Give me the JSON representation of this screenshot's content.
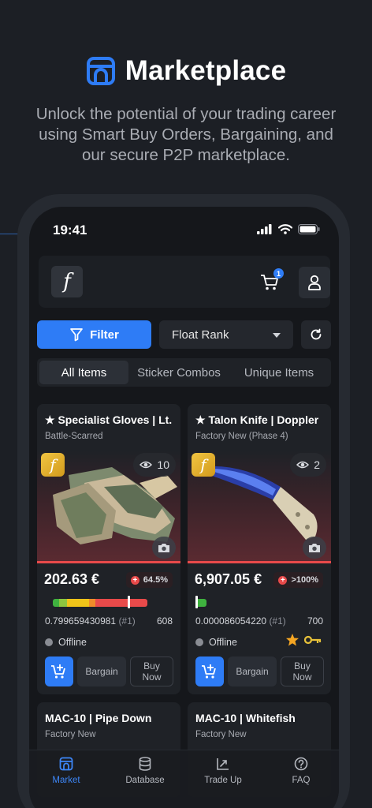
{
  "hero": {
    "title": "Marketplace",
    "subtitle_line1": "Unlock the potential of your trading career",
    "subtitle_line2": "using Smart Buy Orders, Bargaining, and",
    "subtitle_line3": "our secure P2P marketplace."
  },
  "status_bar": {
    "time": "19:41"
  },
  "app_bar": {
    "brand_glyph": "f",
    "cart_badge": "1"
  },
  "toolbar": {
    "filter_label": "Filter",
    "sort_value": "Float Rank"
  },
  "tabs": [
    {
      "label": "All Items",
      "active": true
    },
    {
      "label": "Sticker Combos",
      "active": false
    },
    {
      "label": "Unique Items",
      "active": false
    }
  ],
  "listings": [
    {
      "name": "★ Specialist Gloves | Lt. ...",
      "wear": "Battle-Scarred",
      "views": "10",
      "price": "202.63 €",
      "percent": "64.5%",
      "float_value": "0.799659430981",
      "float_rank": "(#1)",
      "float_number": "608",
      "float_position": 0.7997,
      "seller_status": "Offline",
      "bargain_label": "Bargain",
      "buy_now_line1": "Buy",
      "buy_now_line2": "Now"
    },
    {
      "name": "★ Talon Knife | Doppler",
      "wear": "Factory New (Phase 4)",
      "views": "2",
      "price": "6,907.05 €",
      "percent": ">100%",
      "float_value": "0.000086054220",
      "float_rank": "(#1)",
      "float_number": "700",
      "float_position": 0.0001,
      "seller_status": "Offline",
      "bargain_label": "Bargain",
      "buy_now_line1": "Buy",
      "buy_now_line2": "Now"
    }
  ],
  "more_listings": [
    {
      "name": "MAC-10 | Pipe Down",
      "wear": "Factory New"
    },
    {
      "name": "MAC-10 | Whitefish",
      "wear": "Factory New"
    }
  ],
  "nav": [
    {
      "label": "Market",
      "icon": "market-icon",
      "active": true
    },
    {
      "label": "Database",
      "icon": "database-icon",
      "active": false
    },
    {
      "label": "Trade Up",
      "icon": "trade-up-icon",
      "active": false
    },
    {
      "label": "FAQ",
      "icon": "faq-icon",
      "active": false
    }
  ],
  "colors": {
    "accent": "#2e7cf6",
    "background": "#1c1f25",
    "price_bar_red": "#e84a4a",
    "float_green": "#3fb23f",
    "star": "#f5a623",
    "key": "#e8c23a"
  }
}
